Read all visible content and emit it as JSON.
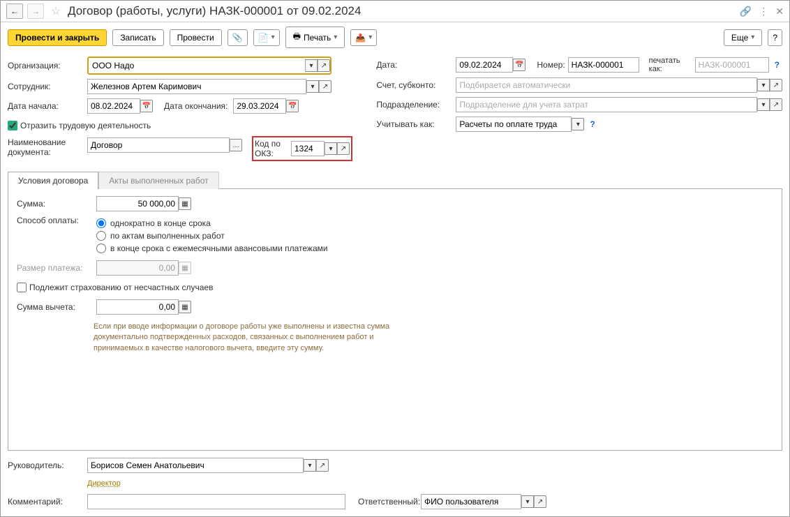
{
  "title": "Договор (работы, услуги) НАЗК-000001 от 09.02.2024",
  "toolbar": {
    "post_close": "Провести и закрыть",
    "save": "Записать",
    "post": "Провести",
    "print": "Печать",
    "more": "Еще"
  },
  "left": {
    "org_label": "Организация:",
    "org_value": "ООО Надо",
    "emp_label": "Сотрудник:",
    "emp_value": "Железнов Артем Каримович",
    "start_label": "Дата начала:",
    "start_value": "08.02.2024",
    "end_label": "Дата окончания:",
    "end_value": "29.03.2024",
    "reflect_label": "Отразить трудовую деятельность",
    "docname_label": "Наименование документа:",
    "docname_value": "Договор",
    "okz_label": "Код по ОКЗ:",
    "okz_value": "1324"
  },
  "right": {
    "date_label": "Дата:",
    "date_value": "09.02.2024",
    "num_label": "Номер:",
    "num_value": "НАЗК-000001",
    "printas_label": "печатать как:",
    "printas_ph": "НАЗК-000001",
    "acct_label": "Счет, субконто:",
    "acct_ph": "Подбирается автоматически",
    "dept_label": "Подразделение:",
    "dept_ph": "Подразделение для учета затрат",
    "account_as_label": "Учитывать как:",
    "account_as_value": "Расчеты по оплате труда"
  },
  "tabs": {
    "terms": "Условия договора",
    "acts": "Акты выполненных работ"
  },
  "terms": {
    "sum_label": "Сумма:",
    "sum_value": "50 000,00",
    "paymode_label": "Способ оплаты:",
    "paymode_opts": [
      "однократно в конце срока",
      "по актам выполненных работ",
      "в конце срока с ежемесячными авансовыми платежами"
    ],
    "payment_size_label": "Размер платежа:",
    "payment_size_value": "0,00",
    "insurance_label": "Подлежит страхованию от несчастных случаев",
    "deduction_label": "Сумма вычета:",
    "deduction_value": "0,00",
    "hint": "Если при вводе информации о договоре работы уже выполнены и известна сумма документально подтвержденных расходов, связанных с выполнением работ и принимаемых в качестве налогового вычета, введите эту сумму."
  },
  "footer": {
    "manager_label": "Руководитель:",
    "manager_value": "Борисов Семен Анатольевич",
    "manager_link": "Директор",
    "comment_label": "Комментарий:",
    "comment_value": "",
    "resp_label": "Ответственный:",
    "resp_value": "ФИО пользователя"
  }
}
